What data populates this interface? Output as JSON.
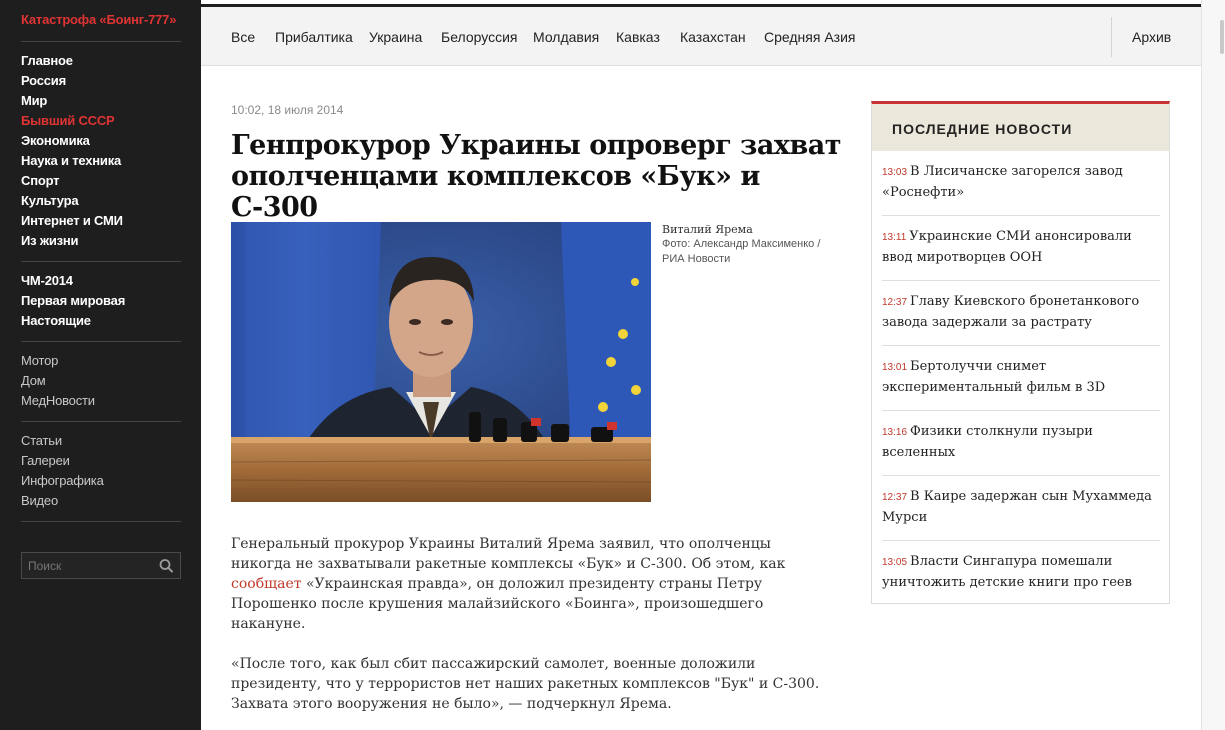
{
  "sidebar": {
    "breaking": "Катастрофа «Боинг-777»",
    "sections": [
      {
        "label": "Главное",
        "active": false
      },
      {
        "label": "Россия",
        "active": false
      },
      {
        "label": "Мир",
        "active": false
      },
      {
        "label": "Бывший СССР",
        "active": true
      },
      {
        "label": "Экономика",
        "active": false
      },
      {
        "label": "Наука и техника",
        "active": false
      },
      {
        "label": "Спорт",
        "active": false
      },
      {
        "label": "Культура",
        "active": false
      },
      {
        "label": "Интернет и СМИ",
        "active": false
      },
      {
        "label": "Из жизни",
        "active": false
      }
    ],
    "specials": [
      {
        "label": "ЧМ-2014"
      },
      {
        "label": "Первая мировая"
      },
      {
        "label": "Настоящие"
      }
    ],
    "projects": [
      {
        "label": "Мотор"
      },
      {
        "label": "Дом"
      },
      {
        "label": "МедНовости"
      }
    ],
    "formats": [
      {
        "label": "Статьи"
      },
      {
        "label": "Галереи"
      },
      {
        "label": "Инфографика"
      },
      {
        "label": "Видео"
      }
    ],
    "search_placeholder": "Поиск"
  },
  "topnav": {
    "items": [
      "Все",
      "Прибалтика",
      "Украина",
      "Белоруссия",
      "Молдавия",
      "Кавказ",
      "Казахстан",
      "Средняя Азия"
    ],
    "archive": "Архив"
  },
  "article": {
    "date": "10:02, 18 июля 2014",
    "headline": "Генпрокурор Украины опроверг захват ополченцами комплексов «Бук» и С-300",
    "photo_caption": {
      "name": "Виталий Ярема",
      "credit": "Фото: Александр Максименко / РИА Новости"
    }
  },
  "main": {
    "body": [
      [
        {
          "text": "Генеральный прокурор Украины Виталий Ярема заявил, что ополченцы никогда не захватывали ракетные комплексы «Бук» и С-300. Об этом, как "
        },
        {
          "text": "сообщает",
          "link": true
        },
        {
          "text": " «Украинская правда», он доложил президенту страны Петру Порошенко после крушения малайзийского «Боинга», произошедшего накануне."
        }
      ],
      [
        {
          "text": "«После того, как был сбит пассажирский самолет, военные доложили президенту, что у террористов нет наших ракетных комплексов \"Бук\" и С-300. Захвата этого вооружения не было», — подчеркнул Ярема."
        }
      ]
    ]
  },
  "latest": {
    "title": "ПОСЛЕДНИЕ НОВОСТИ",
    "items": [
      {
        "time": "13:03",
        "text": "В Лисичанске загорелся завод «Роснефти»"
      },
      {
        "time": "13:11",
        "text": "Украинские СМИ анонсировали ввод миротворцев ООН"
      },
      {
        "time": "12:37",
        "text": "Главу Киевского бронетанкового завода задержали за растрату"
      },
      {
        "time": "13:01",
        "text": "Бертолуччи снимет экспериментальный фильм в 3D"
      },
      {
        "time": "13:16",
        "text": "Физики столкнули пузыри вселенных"
      },
      {
        "time": "12:37",
        "text": "В Каире задержан сын Мухаммеда Мурси"
      },
      {
        "time": "13:05",
        "text": "Власти Сингапура помешали уничтожить детские книги про геев"
      }
    ]
  },
  "colors": {
    "accent": "#e03434",
    "link": "#c0392b",
    "sidebar_bg": "#1e1e1e",
    "news_header_bg": "#ece7db"
  },
  "icons": {
    "search": "search-icon"
  }
}
